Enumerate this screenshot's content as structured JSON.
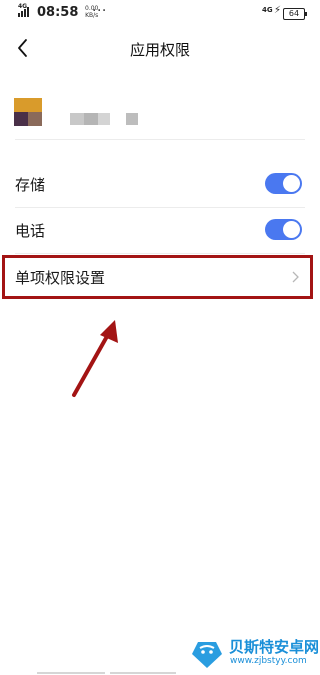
{
  "status_bar": {
    "network_label": "4G",
    "time": "08:58",
    "speed_value": "0.00",
    "speed_unit": "KB/s",
    "more_indicator": "···",
    "network_type": "4G",
    "battery": "64"
  },
  "nav": {
    "title": "应用权限",
    "back_icon": "chevron-left-icon"
  },
  "app_info": {
    "icon": "app-icon",
    "name_obscured": true
  },
  "permissions": [
    {
      "label": "存储",
      "enabled": true
    },
    {
      "label": "电话",
      "enabled": true
    }
  ],
  "single_permission_setting": {
    "label": "单项权限设置",
    "icon": "chevron-right-icon"
  },
  "annotation": {
    "highlight_color": "#a31414",
    "arrow_color": "#a31414"
  },
  "watermark": {
    "title": "贝斯特安卓网",
    "url": "www.zjbstyy.com"
  },
  "colors": {
    "toggle_on": "#4a78f0",
    "watermark": "#1a8fd8"
  }
}
